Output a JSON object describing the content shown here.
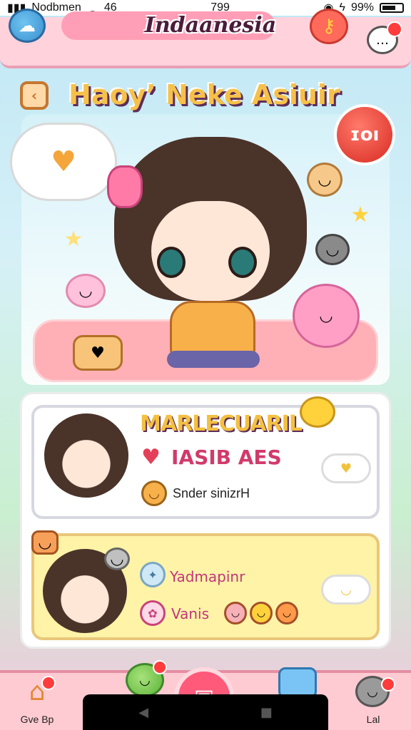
{
  "status_bar": {
    "carrier": "Nodbmen",
    "network": "46",
    "time": "799",
    "battery": "99%"
  },
  "header": {
    "title": "Indaanesia"
  },
  "hero": {
    "title": "Haoy’ Neke Asiuir",
    "badge_text": "ɪoı"
  },
  "cards": [
    {
      "title": "MARLECUARIL",
      "subtitle": "IASIB AES",
      "meta": "Snder sinizrH"
    },
    {
      "line_1": "Yadmapinr",
      "line_2": "Vanis"
    }
  ],
  "bottom_nav": {
    "left_label": "Gve Bp",
    "right_label": "Lal"
  },
  "colors": {
    "header_bg": "#ffd2dc",
    "accent_pink": "#ff9eb6",
    "title_yellow": "#f6c14a",
    "card2_bg": "#fff3a8"
  }
}
